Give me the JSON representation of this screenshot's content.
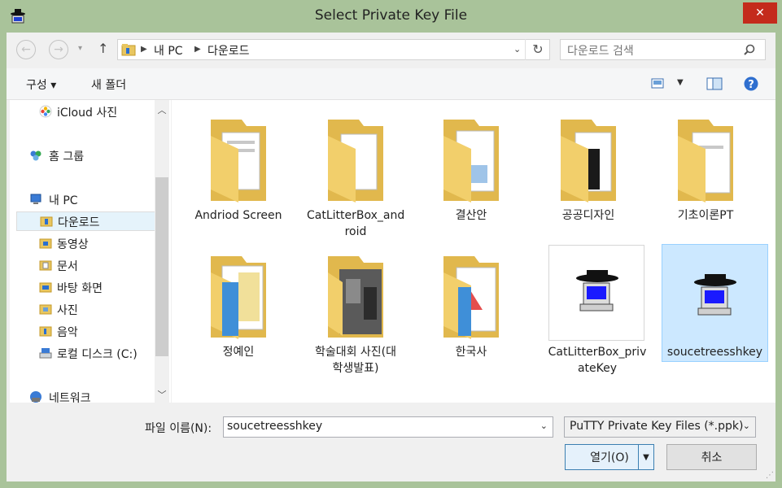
{
  "window": {
    "title": "Select Private Key File"
  },
  "address": {
    "segments": [
      "내 PC",
      "다운로드"
    ]
  },
  "search": {
    "placeholder": "다운로드 검색"
  },
  "toolbar": {
    "organize": "구성 ▾",
    "new_folder": "새 폴더"
  },
  "nav": {
    "items": [
      {
        "label": "iCloud 사진",
        "icon": "photos-icon"
      },
      {
        "label": "홈 그룹",
        "icon": "homegroup-icon"
      },
      {
        "label": "내 PC",
        "icon": "computer-icon"
      },
      {
        "label": "다운로드",
        "icon": "downloads-folder-icon",
        "selected": true
      },
      {
        "label": "동영상",
        "icon": "videos-folder-icon"
      },
      {
        "label": "문서",
        "icon": "documents-folder-icon"
      },
      {
        "label": "바탕 화면",
        "icon": "desktop-folder-icon"
      },
      {
        "label": "사진",
        "icon": "pictures-folder-icon"
      },
      {
        "label": "음악",
        "icon": "music-folder-icon"
      },
      {
        "label": "로컬 디스크 (C:)",
        "icon": "drive-icon"
      },
      {
        "label": "네트워크",
        "icon": "network-icon"
      }
    ]
  },
  "files": [
    {
      "name": "Andriod Screen",
      "type": "folder"
    },
    {
      "name": "CatLitterBox_and\nroid",
      "type": "folder"
    },
    {
      "name": "결산안",
      "type": "folder"
    },
    {
      "name": "공공디자인",
      "type": "folder"
    },
    {
      "name": "기초이론PT",
      "type": "folder"
    },
    {
      "name": "정예인",
      "type": "folder"
    },
    {
      "name": "학술대회 사진(대\n학생발표)",
      "type": "folder"
    },
    {
      "name": "한국사",
      "type": "folder"
    },
    {
      "name": "CatLitterBox_priv\nateKey",
      "type": "ppk"
    },
    {
      "name": "soucetreesshkey",
      "type": "ppk",
      "selected": true
    }
  ],
  "bottom": {
    "filename_label": "파일 이름(N):",
    "filename_value": "soucetreesshkey",
    "filter_value": "PuTTY Private Key Files (*.ppk)",
    "open_label": "열기(O)",
    "cancel_label": "취소"
  },
  "colors": {
    "accent": "#cce8ff",
    "close": "#c42b1c",
    "frame": "#a9c39a"
  }
}
